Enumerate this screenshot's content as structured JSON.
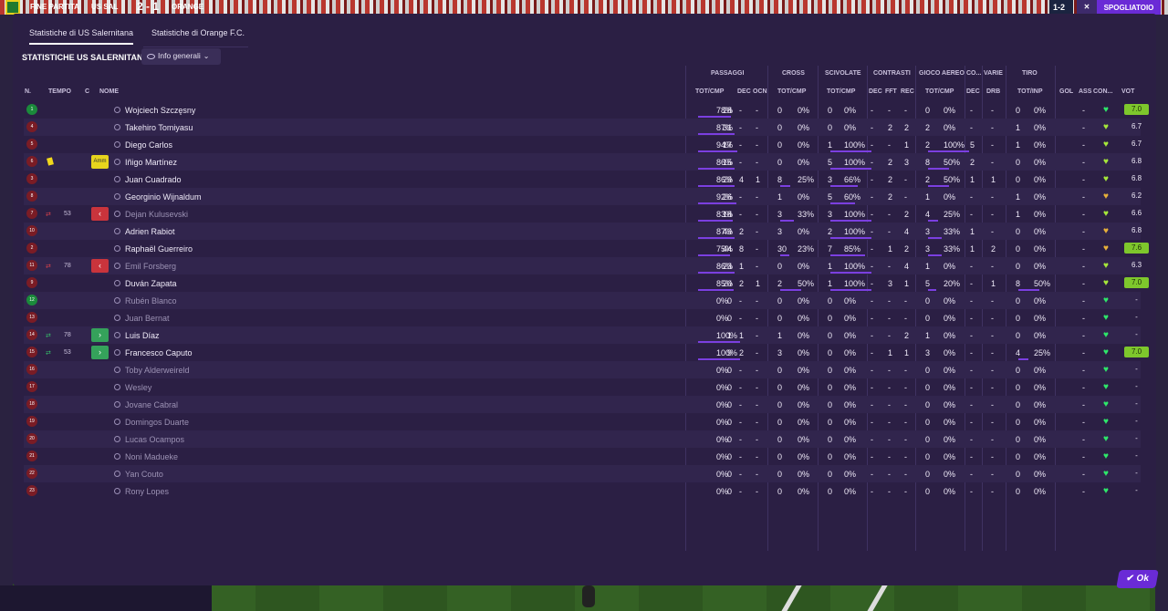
{
  "topbar": {
    "end_label": "FINE PARTITA",
    "home": "US SAL",
    "score": "2 - 1",
    "away": "ORANGE",
    "mini_score": "1-2",
    "btn": "SPOGLIATOIO"
  },
  "tabs": [
    "Statistiche di US Salernitana",
    "Statistiche di Orange F.C."
  ],
  "section_title": "STATISTICHE US SALERNITANA",
  "view_dropdown": "Info generali",
  "groups": {
    "passaggi": "PASSAGGI",
    "cross": "CROSS",
    "scivolate": "SCIVOLATE",
    "contrasti": "CONTRASTI",
    "gioco_aereo": "GIOCO AEREO",
    "co": "CO...",
    "varie": "VARIE",
    "tiro": "TIRO"
  },
  "subheaders": {
    "n": "N.",
    "tempo": "TEMPO",
    "c": "C",
    "nome": "NOME",
    "tot_cmp": "TOT/CMP",
    "dec": "DEC",
    "ocn": "OCN",
    "tot_cmp2": "TOT/CMP",
    "tot_cmp3": "TOT/CMP",
    "dec2": "DEC",
    "fft": "FFT",
    "rec": "REC",
    "tot_cmp4": "TOT/CMP",
    "dec3": "DEC",
    "drb": "DRB",
    "tot_inp": "TOT/INP",
    "gol": "GOL",
    "ass": "ASS",
    "con": "CON...",
    "vot": "VOT"
  },
  "players": [
    {
      "n": "1",
      "time": "",
      "c": "",
      "name": "Wojciech Szczęsny",
      "p_t": "28",
      "p_p": "78%",
      "p_d": "-",
      "p_o": "-",
      "cr_t": "0",
      "cr_p": "0%",
      "sc_t": "0",
      "sc_p": "0%",
      "ct_d": "-",
      "ct_f": "-",
      "ct_r": "-",
      "ga_t": "0",
      "ga_p": "0%",
      "co_d": "-",
      "va_d": "-",
      "ti_t": "0",
      "ti_p": "0%",
      "gol": "",
      "ass": "-",
      "vot": "7.0",
      "vot_hi": true,
      "gk": true,
      "dim": false,
      "heart": "#2ee86a"
    },
    {
      "n": "4",
      "time": "",
      "c": "",
      "name": "Takehiro Tomiyasu",
      "p_t": "31",
      "p_p": "87%",
      "p_d": "-",
      "p_o": "-",
      "cr_t": "0",
      "cr_p": "0%",
      "sc_t": "0",
      "sc_p": "0%",
      "ct_d": "-",
      "ct_f": "2",
      "ct_r": "2",
      "ga_t": "2",
      "ga_p": "0%",
      "co_d": "-",
      "va_d": "-",
      "ti_t": "1",
      "ti_p": "0%",
      "gol": "",
      "ass": "-",
      "vot": "6.7",
      "vot_hi": false,
      "gk": false,
      "dim": false,
      "heart": "#a6e83a"
    },
    {
      "n": "5",
      "time": "",
      "c": "",
      "name": "Diego Carlos",
      "p_t": "17",
      "p_p": "94%",
      "p_d": "-",
      "p_o": "-",
      "cr_t": "0",
      "cr_p": "0%",
      "sc_t": "1",
      "sc_p": "100%",
      "ct_d": "-",
      "ct_f": "-",
      "ct_r": "1",
      "ga_t": "2",
      "ga_p": "100%",
      "co_d": "5",
      "va_d": "-",
      "ti_t": "1",
      "ti_p": "0%",
      "gol": "",
      "ass": "-",
      "vot": "6.7",
      "vot_hi": false,
      "gk": false,
      "dim": false,
      "heart": "#a6e83a"
    },
    {
      "n": "6",
      "time": "",
      "c": "Amm",
      "name": "Iñigo Martínez",
      "p_t": "15",
      "p_p": "86%",
      "p_d": "-",
      "p_o": "-",
      "cr_t": "0",
      "cr_p": "0%",
      "sc_t": "5",
      "sc_p": "100%",
      "ct_d": "-",
      "ct_f": "2",
      "ct_r": "3",
      "ga_t": "8",
      "ga_p": "50%",
      "co_d": "2",
      "va_d": "-",
      "ti_t": "0",
      "ti_p": "0%",
      "gol": "",
      "ass": "-",
      "vot": "6.8",
      "vot_hi": false,
      "gk": false,
      "dim": false,
      "heart": "#a6e83a",
      "yellow": true
    },
    {
      "n": "3",
      "time": "",
      "c": "",
      "name": "Juan Cuadrado",
      "p_t": "29",
      "p_p": "86%",
      "p_d": "4",
      "p_o": "1",
      "cr_t": "8",
      "cr_p": "25%",
      "sc_t": "3",
      "sc_p": "66%",
      "ct_d": "-",
      "ct_f": "2",
      "ct_r": "-",
      "ga_t": "2",
      "ga_p": "50%",
      "co_d": "1",
      "va_d": "1",
      "ti_t": "0",
      "ti_p": "0%",
      "gol": "",
      "ass": "-",
      "vot": "6.8",
      "vot_hi": false,
      "gk": false,
      "dim": false,
      "heart": "#a6e83a"
    },
    {
      "n": "8",
      "time": "",
      "c": "",
      "name": "Georginio Wijnaldum",
      "p_t": "26",
      "p_p": "92%",
      "p_d": "-",
      "p_o": "-",
      "cr_t": "1",
      "cr_p": "0%",
      "sc_t": "5",
      "sc_p": "60%",
      "ct_d": "-",
      "ct_f": "2",
      "ct_r": "-",
      "ga_t": "1",
      "ga_p": "0%",
      "co_d": "-",
      "va_d": "-",
      "ti_t": "1",
      "ti_p": "0%",
      "gol": "",
      "ass": "-",
      "vot": "6.2",
      "vot_hi": false,
      "gk": false,
      "dim": false,
      "heart": "#e8b13a"
    },
    {
      "n": "7",
      "time": "53",
      "c": "out",
      "name": "Dejan Kulusevski",
      "p_t": "18",
      "p_p": "83%",
      "p_d": "-",
      "p_o": "-",
      "cr_t": "3",
      "cr_p": "33%",
      "sc_t": "3",
      "sc_p": "100%",
      "ct_d": "-",
      "ct_f": "-",
      "ct_r": "2",
      "ga_t": "4",
      "ga_p": "25%",
      "co_d": "-",
      "va_d": "-",
      "ti_t": "1",
      "ti_p": "0%",
      "gol": "",
      "ass": "-",
      "vot": "6.6",
      "vot_hi": false,
      "gk": false,
      "dim": true,
      "heart": "#a6e83a",
      "sub": "out"
    },
    {
      "n": "10",
      "time": "",
      "c": "",
      "name": "Adrien Rabiot",
      "p_t": "49",
      "p_p": "87%",
      "p_d": "2",
      "p_o": "-",
      "cr_t": "3",
      "cr_p": "0%",
      "sc_t": "2",
      "sc_p": "100%",
      "ct_d": "-",
      "ct_f": "-",
      "ct_r": "4",
      "ga_t": "3",
      "ga_p": "33%",
      "co_d": "1",
      "va_d": "-",
      "ti_t": "0",
      "ti_p": "0%",
      "gol": "",
      "ass": "-",
      "vot": "6.8",
      "vot_hi": false,
      "gk": false,
      "dim": false,
      "heart": "#e8b13a"
    },
    {
      "n": "2",
      "time": "",
      "c": "",
      "name": "Raphaël Guerreiro",
      "p_t": "44",
      "p_p": "75%",
      "p_d": "8",
      "p_o": "-",
      "cr_t": "30",
      "cr_p": "23%",
      "sc_t": "7",
      "sc_p": "85%",
      "ct_d": "-",
      "ct_f": "1",
      "ct_r": "2",
      "ga_t": "3",
      "ga_p": "33%",
      "co_d": "1",
      "va_d": "2",
      "ti_t": "0",
      "ti_p": "0%",
      "gol": "",
      "ass": "-",
      "vot": "7.6",
      "vot_hi": true,
      "gk": false,
      "dim": false,
      "heart": "#e8b13a"
    },
    {
      "n": "11",
      "time": "78",
      "c": "out",
      "name": "Emil Forsberg",
      "p_t": "23",
      "p_p": "86%",
      "p_d": "1",
      "p_o": "-",
      "cr_t": "0",
      "cr_p": "0%",
      "sc_t": "1",
      "sc_p": "100%",
      "ct_d": "-",
      "ct_f": "-",
      "ct_r": "4",
      "ga_t": "1",
      "ga_p": "0%",
      "co_d": "-",
      "va_d": "-",
      "ti_t": "0",
      "ti_p": "0%",
      "gol": "",
      "ass": "-",
      "vot": "6.3",
      "vot_hi": false,
      "gk": false,
      "dim": true,
      "heart": "#a6e83a",
      "sub": "out"
    },
    {
      "n": "9",
      "time": "",
      "c": "",
      "name": "Duván Zapata",
      "p_t": "20",
      "p_p": "85%",
      "p_d": "2",
      "p_o": "1",
      "cr_t": "2",
      "cr_p": "50%",
      "sc_t": "1",
      "sc_p": "100%",
      "ct_d": "-",
      "ct_f": "3",
      "ct_r": "1",
      "ga_t": "5",
      "ga_p": "20%",
      "co_d": "-",
      "va_d": "1",
      "ti_t": "8",
      "ti_p": "50%",
      "gol": "",
      "ass": "-",
      "vot": "7.0",
      "vot_hi": true,
      "gk": false,
      "dim": false,
      "heart": "#a6e83a"
    },
    {
      "n": "12",
      "time": "",
      "c": "",
      "name": "Rubén Blanco",
      "p_t": "0",
      "p_p": "0%",
      "p_d": "-",
      "p_o": "-",
      "cr_t": "0",
      "cr_p": "0%",
      "sc_t": "0",
      "sc_p": "0%",
      "ct_d": "-",
      "ct_f": "-",
      "ct_r": "-",
      "ga_t": "0",
      "ga_p": "0%",
      "co_d": "-",
      "va_d": "-",
      "ti_t": "0",
      "ti_p": "0%",
      "gol": "",
      "ass": "-",
      "vot": "-",
      "vot_hi": false,
      "gk": true,
      "dim": true,
      "heart": "#2ee86a"
    },
    {
      "n": "13",
      "time": "",
      "c": "",
      "name": "Juan Bernat",
      "p_t": "0",
      "p_p": "0%",
      "p_d": "-",
      "p_o": "-",
      "cr_t": "0",
      "cr_p": "0%",
      "sc_t": "0",
      "sc_p": "0%",
      "ct_d": "-",
      "ct_f": "-",
      "ct_r": "-",
      "ga_t": "0",
      "ga_p": "0%",
      "co_d": "-",
      "va_d": "-",
      "ti_t": "0",
      "ti_p": "0%",
      "gol": "",
      "ass": "-",
      "vot": "-",
      "vot_hi": false,
      "gk": false,
      "dim": true,
      "heart": "#2ee86a"
    },
    {
      "n": "14",
      "time": "78",
      "c": "in",
      "name": "Luis Díaz",
      "p_t": "1",
      "p_p": "100%",
      "p_d": "1",
      "p_o": "-",
      "cr_t": "1",
      "cr_p": "0%",
      "sc_t": "0",
      "sc_p": "0%",
      "ct_d": "-",
      "ct_f": "-",
      "ct_r": "2",
      "ga_t": "1",
      "ga_p": "0%",
      "co_d": "-",
      "va_d": "-",
      "ti_t": "0",
      "ti_p": "0%",
      "gol": "",
      "ass": "-",
      "vot": "-",
      "vot_hi": false,
      "gk": false,
      "dim": false,
      "heart": "#2ee86a",
      "sub": "in"
    },
    {
      "n": "15",
      "time": "53",
      "c": "in",
      "name": "Francesco Caputo",
      "p_t": "9",
      "p_p": "100%",
      "p_d": "2",
      "p_o": "-",
      "cr_t": "3",
      "cr_p": "0%",
      "sc_t": "0",
      "sc_p": "0%",
      "ct_d": "-",
      "ct_f": "1",
      "ct_r": "1",
      "ga_t": "3",
      "ga_p": "0%",
      "co_d": "-",
      "va_d": "-",
      "ti_t": "4",
      "ti_p": "25%",
      "gol": "",
      "ass": "-",
      "vot": "7.0",
      "vot_hi": true,
      "gk": false,
      "dim": false,
      "heart": "#2ee86a",
      "sub": "in"
    },
    {
      "n": "16",
      "time": "",
      "c": "",
      "name": "Toby Alderweireld",
      "p_t": "0",
      "p_p": "0%",
      "p_d": "-",
      "p_o": "-",
      "cr_t": "0",
      "cr_p": "0%",
      "sc_t": "0",
      "sc_p": "0%",
      "ct_d": "-",
      "ct_f": "-",
      "ct_r": "-",
      "ga_t": "0",
      "ga_p": "0%",
      "co_d": "-",
      "va_d": "-",
      "ti_t": "0",
      "ti_p": "0%",
      "gol": "",
      "ass": "-",
      "vot": "-",
      "vot_hi": false,
      "gk": false,
      "dim": true,
      "heart": "#2ee86a"
    },
    {
      "n": "17",
      "time": "",
      "c": "",
      "name": "Wesley",
      "p_t": "0",
      "p_p": "0%",
      "p_d": "-",
      "p_o": "-",
      "cr_t": "0",
      "cr_p": "0%",
      "sc_t": "0",
      "sc_p": "0%",
      "ct_d": "-",
      "ct_f": "-",
      "ct_r": "-",
      "ga_t": "0",
      "ga_p": "0%",
      "co_d": "-",
      "va_d": "-",
      "ti_t": "0",
      "ti_p": "0%",
      "gol": "",
      "ass": "-",
      "vot": "-",
      "vot_hi": false,
      "gk": false,
      "dim": true,
      "heart": "#2ee86a"
    },
    {
      "n": "18",
      "time": "",
      "c": "",
      "name": "Jovane Cabral",
      "p_t": "0",
      "p_p": "0%",
      "p_d": "-",
      "p_o": "-",
      "cr_t": "0",
      "cr_p": "0%",
      "sc_t": "0",
      "sc_p": "0%",
      "ct_d": "-",
      "ct_f": "-",
      "ct_r": "-",
      "ga_t": "0",
      "ga_p": "0%",
      "co_d": "-",
      "va_d": "-",
      "ti_t": "0",
      "ti_p": "0%",
      "gol": "",
      "ass": "-",
      "vot": "-",
      "vot_hi": false,
      "gk": false,
      "dim": true,
      "heart": "#2ee86a"
    },
    {
      "n": "19",
      "time": "",
      "c": "",
      "name": "Domingos Duarte",
      "p_t": "0",
      "p_p": "0%",
      "p_d": "-",
      "p_o": "-",
      "cr_t": "0",
      "cr_p": "0%",
      "sc_t": "0",
      "sc_p": "0%",
      "ct_d": "-",
      "ct_f": "-",
      "ct_r": "-",
      "ga_t": "0",
      "ga_p": "0%",
      "co_d": "-",
      "va_d": "-",
      "ti_t": "0",
      "ti_p": "0%",
      "gol": "",
      "ass": "-",
      "vot": "-",
      "vot_hi": false,
      "gk": false,
      "dim": true,
      "heart": "#2ee86a"
    },
    {
      "n": "20",
      "time": "",
      "c": "",
      "name": "Lucas Ocampos",
      "p_t": "0",
      "p_p": "0%",
      "p_d": "-",
      "p_o": "-",
      "cr_t": "0",
      "cr_p": "0%",
      "sc_t": "0",
      "sc_p": "0%",
      "ct_d": "-",
      "ct_f": "-",
      "ct_r": "-",
      "ga_t": "0",
      "ga_p": "0%",
      "co_d": "-",
      "va_d": "-",
      "ti_t": "0",
      "ti_p": "0%",
      "gol": "",
      "ass": "-",
      "vot": "-",
      "vot_hi": false,
      "gk": false,
      "dim": true,
      "heart": "#2ee86a"
    },
    {
      "n": "21",
      "time": "",
      "c": "",
      "name": "Noni Madueke",
      "p_t": "0",
      "p_p": "0%",
      "p_d": "-",
      "p_o": "-",
      "cr_t": "0",
      "cr_p": "0%",
      "sc_t": "0",
      "sc_p": "0%",
      "ct_d": "-",
      "ct_f": "-",
      "ct_r": "-",
      "ga_t": "0",
      "ga_p": "0%",
      "co_d": "-",
      "va_d": "-",
      "ti_t": "0",
      "ti_p": "0%",
      "gol": "",
      "ass": "-",
      "vot": "-",
      "vot_hi": false,
      "gk": false,
      "dim": true,
      "heart": "#2ee86a"
    },
    {
      "n": "22",
      "time": "",
      "c": "",
      "name": "Yan Couto",
      "p_t": "0",
      "p_p": "0%",
      "p_d": "-",
      "p_o": "-",
      "cr_t": "0",
      "cr_p": "0%",
      "sc_t": "0",
      "sc_p": "0%",
      "ct_d": "-",
      "ct_f": "-",
      "ct_r": "-",
      "ga_t": "0",
      "ga_p": "0%",
      "co_d": "-",
      "va_d": "-",
      "ti_t": "0",
      "ti_p": "0%",
      "gol": "",
      "ass": "-",
      "vot": "-",
      "vot_hi": false,
      "gk": false,
      "dim": true,
      "heart": "#2ee86a"
    },
    {
      "n": "23",
      "time": "",
      "c": "",
      "name": "Rony Lopes",
      "p_t": "0",
      "p_p": "0%",
      "p_d": "-",
      "p_o": "-",
      "cr_t": "0",
      "cr_p": "0%",
      "sc_t": "0",
      "sc_p": "0%",
      "ct_d": "-",
      "ct_f": "-",
      "ct_r": "-",
      "ga_t": "0",
      "ga_p": "0%",
      "co_d": "-",
      "va_d": "-",
      "ti_t": "0",
      "ti_p": "0%",
      "gol": "",
      "ass": "-",
      "vot": "-",
      "vot_hi": false,
      "gk": false,
      "dim": true,
      "heart": "#2ee86a"
    }
  ],
  "ok_label": "Ok",
  "colors": {
    "accent": "#6a2bd6",
    "bar": "#7b3fe0",
    "panel": "#2b1f44",
    "high_rating": "#7ec72c"
  }
}
